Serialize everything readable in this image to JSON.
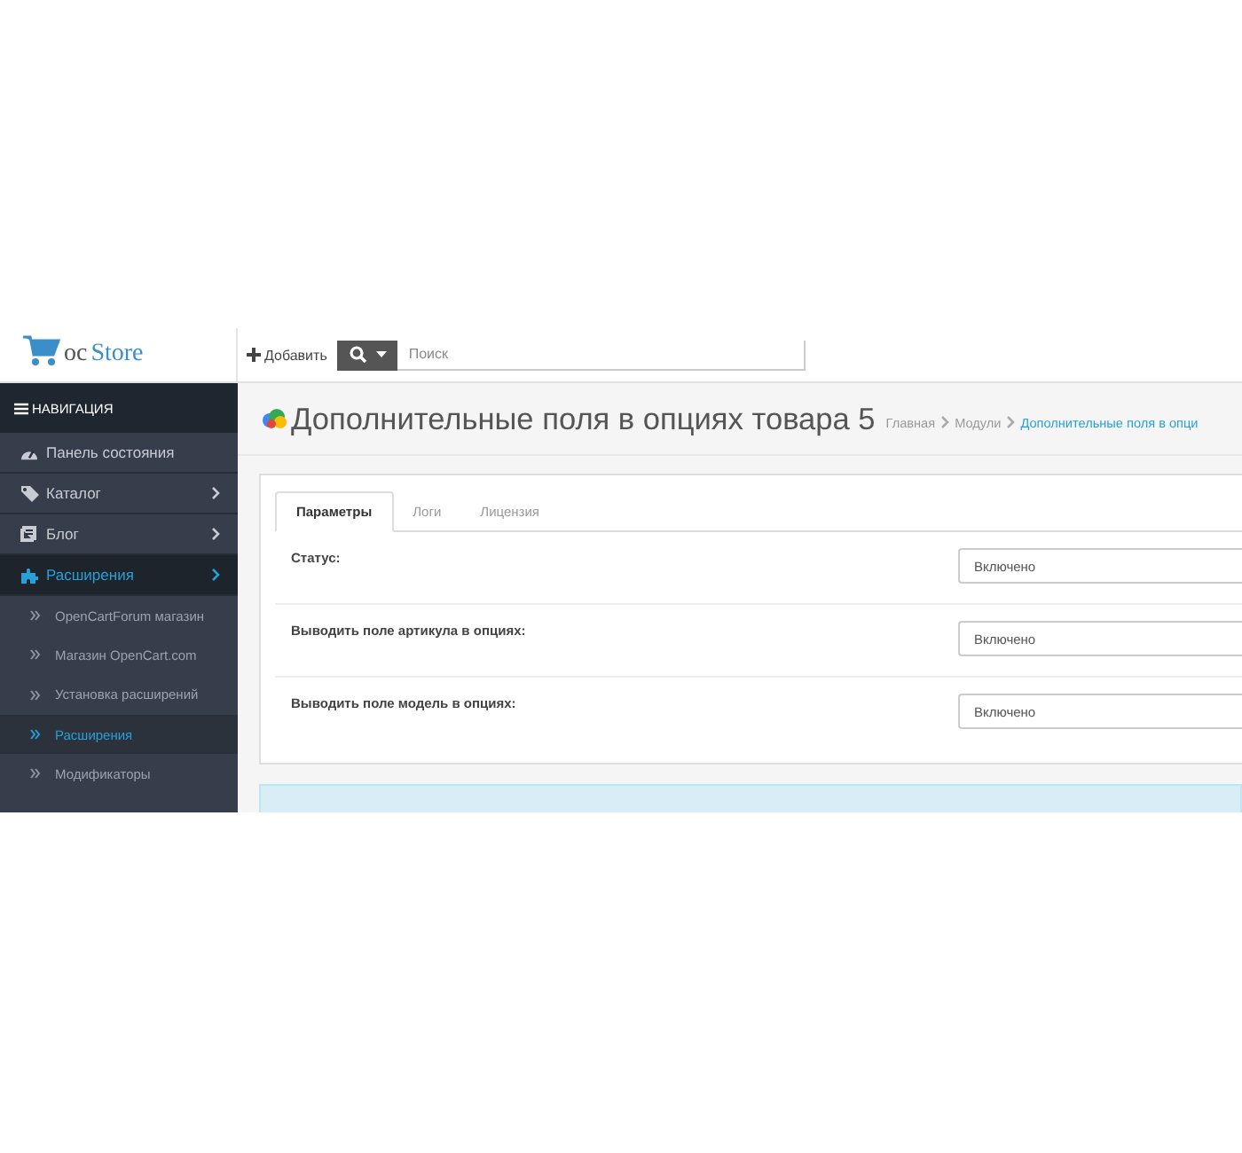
{
  "header": {
    "logo": {
      "prefix": "oc",
      "name": "Store"
    },
    "add_button": "Добавить",
    "search": {
      "placeholder": "Поиск"
    }
  },
  "sidebar": {
    "heading": "НАВИГАЦИЯ",
    "items": [
      {
        "label": "Панель состояния",
        "selected": false,
        "has_children": false
      },
      {
        "label": "Каталог",
        "selected": false,
        "has_children": true
      },
      {
        "label": "Блог",
        "selected": false,
        "has_children": true
      },
      {
        "label": "Расширения",
        "selected": true,
        "has_children": true,
        "children": [
          {
            "label": "OpenCartForum магазин",
            "selected": false
          },
          {
            "label": "Магазин OpenCart.com",
            "selected": false
          },
          {
            "label": "Установка расширений",
            "selected": false
          },
          {
            "label": "Расширения",
            "selected": true
          },
          {
            "label": "Модификаторы",
            "selected": false
          }
        ]
      }
    ]
  },
  "content": {
    "title": "Дополнительные поля в опциях товара 5",
    "breadcrumbs": [
      {
        "label": "Главная",
        "selected": false
      },
      {
        "label": "Модули",
        "selected": false
      },
      {
        "label": "Дополнительные поля в опци",
        "selected": true
      }
    ],
    "tabs": [
      {
        "label": "Параметры",
        "selected": true
      },
      {
        "label": "Логи",
        "selected": false
      },
      {
        "label": "Лицензия",
        "selected": false
      }
    ],
    "fields": [
      {
        "label": "Статус:",
        "value": "Включено"
      },
      {
        "label": "Выводить поле артикула в опциях:",
        "value": "Включено"
      },
      {
        "label": "Выводить поле модель в опциях:",
        "value": "Включено"
      }
    ]
  }
}
